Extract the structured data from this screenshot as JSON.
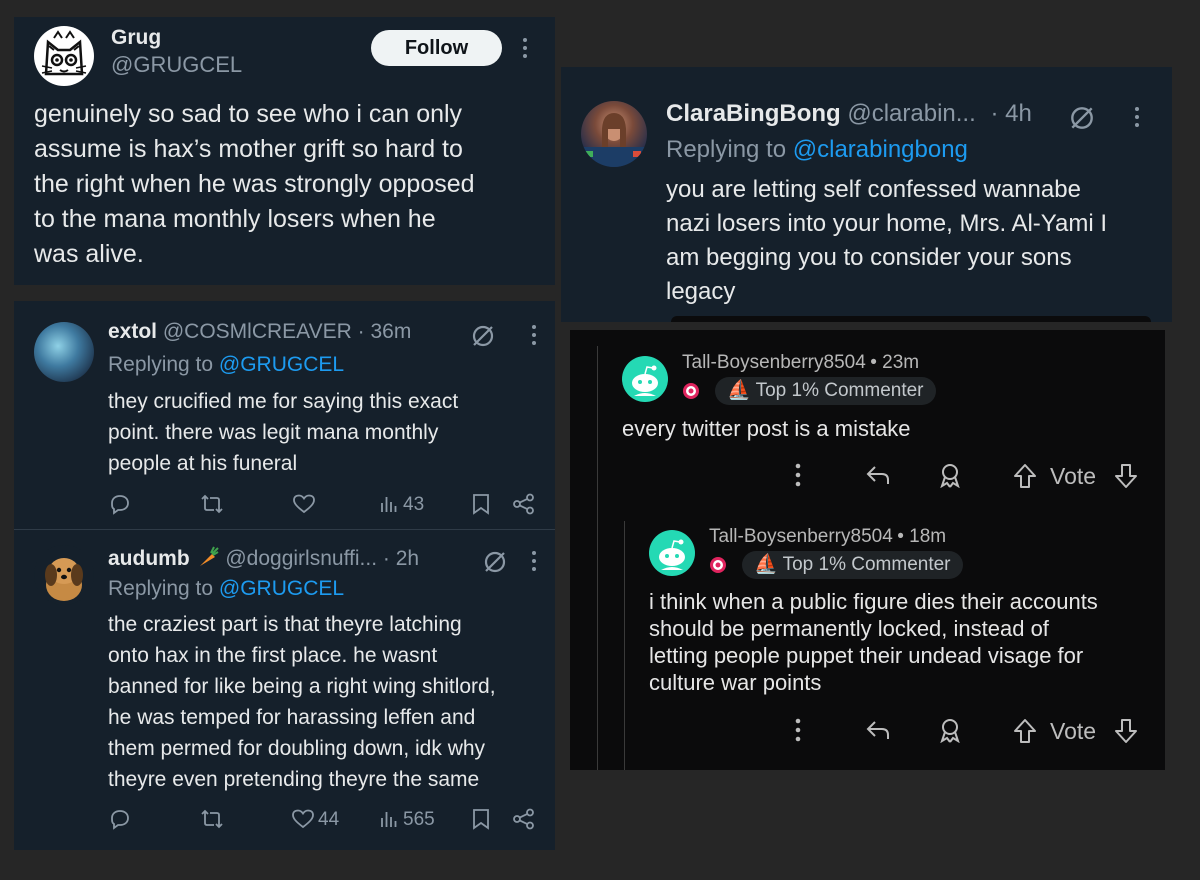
{
  "grug_post": {
    "name": "Grug",
    "handle": "@GRUGCEL",
    "follow_label": "Follow",
    "text_lines": [
      "genuinely so sad to see who i can only",
      "assume is hax’s mother grift so hard to",
      "the right when he was strongly opposed",
      "to the mana monthly losers when he",
      "was alive."
    ]
  },
  "replies": [
    {
      "name": "extol",
      "handle": "@COSMlCREAVER",
      "time": "· 36m",
      "replying_prefix": "Replying to",
      "replying_to": "@GRUGCEL",
      "text_lines": [
        "they crucified me for saying this exact",
        "point. there was legit mana monthly",
        "people at his funeral"
      ],
      "likes": "",
      "views": "43"
    },
    {
      "name": "audumb",
      "handle": "@doggirlsnuffi...",
      "time": "· 2h",
      "replying_prefix": "Replying to",
      "replying_to": "@GRUGCEL",
      "text_lines": [
        "the craziest part is that theyre latching",
        "onto hax in the first place. he wasnt",
        "banned for like being a right wing shitlord,",
        "he was temped for harassing leffen and",
        "them permed for doubling down, idk why",
        "theyre even pretending theyre the same"
      ],
      "likes": "44",
      "views": "565"
    }
  ],
  "clara_post": {
    "name": "ClaraBingBong",
    "handle": "@clarabin...",
    "time": "· 4h",
    "replying_prefix": "Replying to",
    "replying_to": "@clarabingbong",
    "text_lines": [
      "you are letting self confessed wannabe",
      "nazi losers into your home, Mrs. Al-Yami I",
      "am begging you to consider your sons",
      "legacy"
    ]
  },
  "reddit_comments": [
    {
      "username": "Tall-Boysenberry8504",
      "time": "• 23m",
      "badge": "Top 1% Commenter",
      "text_lines": [
        "every twitter post is a mistake"
      ],
      "vote_label": "Vote"
    },
    {
      "username": "Tall-Boysenberry8504",
      "time": "• 18m",
      "badge": "Top 1% Commenter",
      "text_lines": [
        "i think when a public figure dies their accounts",
        "should be permanently locked, instead of",
        "letting people puppet their undead visage for",
        "culture war points"
      ],
      "vote_label": "Vote"
    }
  ],
  "colors": {
    "twitter_bg": "#15202b",
    "twitter_link": "#1d9bf0",
    "reddit_bg": "#0b0b0c",
    "reddit_avatar": "#24d9b4",
    "page_bg": "#262626"
  },
  "icons": [
    "more-icon",
    "grok-icon",
    "reply-icon",
    "retweet-icon",
    "like-icon",
    "views-icon",
    "bookmark-icon",
    "share-icon",
    "upvote-icon",
    "downvote-icon",
    "award-icon",
    "snoo-avatar-icon",
    "target-icon"
  ]
}
